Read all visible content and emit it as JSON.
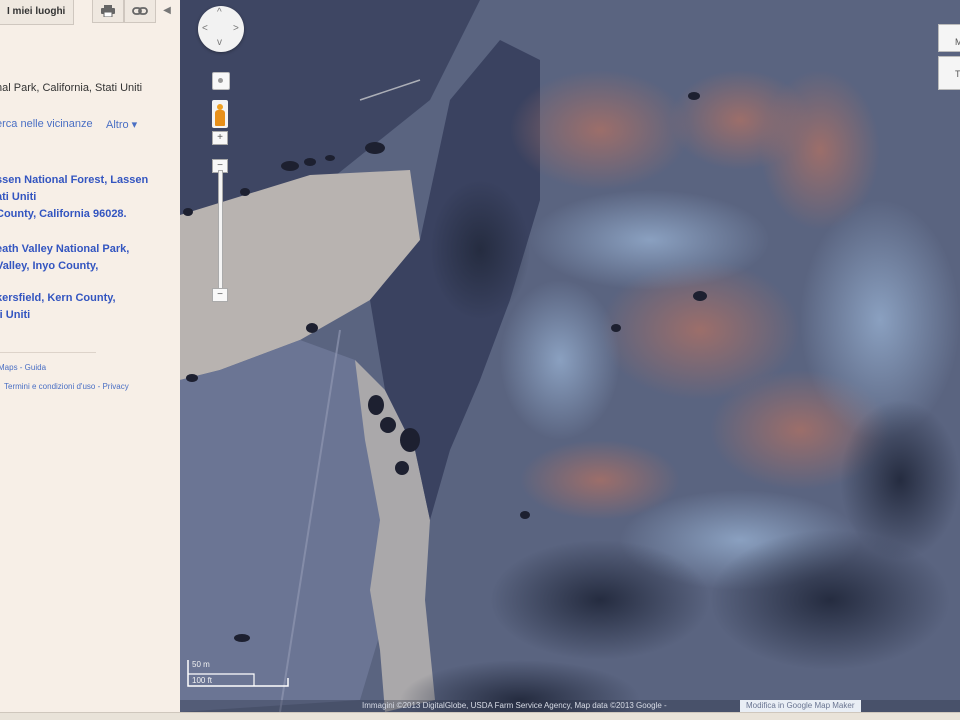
{
  "panel": {
    "my_places": "I miei luoghi",
    "address": "nal Park, California, Stati Uniti",
    "nearby": "erca nelle vicinanze",
    "more": "Altro",
    "results": [
      {
        "line1": "ssen National Forest, Lassen",
        "line2": "ati Uniti"
      },
      {
        "line1": "County, California 96028.",
        "line2": ""
      },
      {
        "line1": "eath Valley National Park,",
        "line2": "Valley, Inyo County,"
      },
      {
        "line1": "kersfield, Kern County,",
        "line2": "ti Uniti"
      }
    ],
    "footer_links": "Maps - Guida",
    "terms_links": "Termini e condizioni d'uso - Privacy"
  },
  "map": {
    "scale_metric": "50 m",
    "scale_imperial": "100 ft",
    "copyright": "Immagini ©2013 DigitalGlobe, USDA Farm Service Agency, Map data ©2013 Google -",
    "map_maker_link": "Modifica in Google Map Maker",
    "map_type_buttons": [
      "M",
      "T"
    ]
  },
  "icons": {
    "print": "print-icon",
    "link": "link-icon",
    "collapse": "collapse-arrow-icon",
    "pan": "pan-control-icon",
    "pegman": "street-view-pegman-icon"
  },
  "colors": {
    "link_blue": "#3355c0",
    "panel_bg": "#f7efe7"
  }
}
